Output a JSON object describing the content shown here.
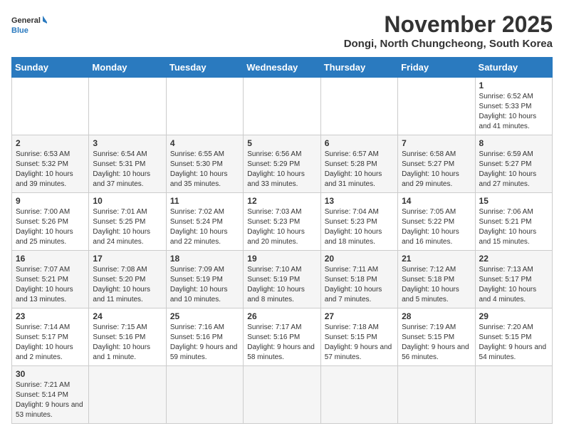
{
  "logo": {
    "text_general": "General",
    "text_blue": "Blue"
  },
  "header": {
    "title": "November 2025",
    "subtitle": "Dongi, North Chungcheong, South Korea"
  },
  "weekdays": [
    "Sunday",
    "Monday",
    "Tuesday",
    "Wednesday",
    "Thursday",
    "Friday",
    "Saturday"
  ],
  "weeks": [
    [
      {
        "day": "",
        "info": ""
      },
      {
        "day": "",
        "info": ""
      },
      {
        "day": "",
        "info": ""
      },
      {
        "day": "",
        "info": ""
      },
      {
        "day": "",
        "info": ""
      },
      {
        "day": "",
        "info": ""
      },
      {
        "day": "1",
        "info": "Sunrise: 6:52 AM\nSunset: 5:33 PM\nDaylight: 10 hours and 41 minutes."
      }
    ],
    [
      {
        "day": "2",
        "info": "Sunrise: 6:53 AM\nSunset: 5:32 PM\nDaylight: 10 hours and 39 minutes."
      },
      {
        "day": "3",
        "info": "Sunrise: 6:54 AM\nSunset: 5:31 PM\nDaylight: 10 hours and 37 minutes."
      },
      {
        "day": "4",
        "info": "Sunrise: 6:55 AM\nSunset: 5:30 PM\nDaylight: 10 hours and 35 minutes."
      },
      {
        "day": "5",
        "info": "Sunrise: 6:56 AM\nSunset: 5:29 PM\nDaylight: 10 hours and 33 minutes."
      },
      {
        "day": "6",
        "info": "Sunrise: 6:57 AM\nSunset: 5:28 PM\nDaylight: 10 hours and 31 minutes."
      },
      {
        "day": "7",
        "info": "Sunrise: 6:58 AM\nSunset: 5:27 PM\nDaylight: 10 hours and 29 minutes."
      },
      {
        "day": "8",
        "info": "Sunrise: 6:59 AM\nSunset: 5:27 PM\nDaylight: 10 hours and 27 minutes."
      }
    ],
    [
      {
        "day": "9",
        "info": "Sunrise: 7:00 AM\nSunset: 5:26 PM\nDaylight: 10 hours and 25 minutes."
      },
      {
        "day": "10",
        "info": "Sunrise: 7:01 AM\nSunset: 5:25 PM\nDaylight: 10 hours and 24 minutes."
      },
      {
        "day": "11",
        "info": "Sunrise: 7:02 AM\nSunset: 5:24 PM\nDaylight: 10 hours and 22 minutes."
      },
      {
        "day": "12",
        "info": "Sunrise: 7:03 AM\nSunset: 5:23 PM\nDaylight: 10 hours and 20 minutes."
      },
      {
        "day": "13",
        "info": "Sunrise: 7:04 AM\nSunset: 5:23 PM\nDaylight: 10 hours and 18 minutes."
      },
      {
        "day": "14",
        "info": "Sunrise: 7:05 AM\nSunset: 5:22 PM\nDaylight: 10 hours and 16 minutes."
      },
      {
        "day": "15",
        "info": "Sunrise: 7:06 AM\nSunset: 5:21 PM\nDaylight: 10 hours and 15 minutes."
      }
    ],
    [
      {
        "day": "16",
        "info": "Sunrise: 7:07 AM\nSunset: 5:21 PM\nDaylight: 10 hours and 13 minutes."
      },
      {
        "day": "17",
        "info": "Sunrise: 7:08 AM\nSunset: 5:20 PM\nDaylight: 10 hours and 11 minutes."
      },
      {
        "day": "18",
        "info": "Sunrise: 7:09 AM\nSunset: 5:19 PM\nDaylight: 10 hours and 10 minutes."
      },
      {
        "day": "19",
        "info": "Sunrise: 7:10 AM\nSunset: 5:19 PM\nDaylight: 10 hours and 8 minutes."
      },
      {
        "day": "20",
        "info": "Sunrise: 7:11 AM\nSunset: 5:18 PM\nDaylight: 10 hours and 7 minutes."
      },
      {
        "day": "21",
        "info": "Sunrise: 7:12 AM\nSunset: 5:18 PM\nDaylight: 10 hours and 5 minutes."
      },
      {
        "day": "22",
        "info": "Sunrise: 7:13 AM\nSunset: 5:17 PM\nDaylight: 10 hours and 4 minutes."
      }
    ],
    [
      {
        "day": "23",
        "info": "Sunrise: 7:14 AM\nSunset: 5:17 PM\nDaylight: 10 hours and 2 minutes."
      },
      {
        "day": "24",
        "info": "Sunrise: 7:15 AM\nSunset: 5:16 PM\nDaylight: 10 hours and 1 minute."
      },
      {
        "day": "25",
        "info": "Sunrise: 7:16 AM\nSunset: 5:16 PM\nDaylight: 9 hours and 59 minutes."
      },
      {
        "day": "26",
        "info": "Sunrise: 7:17 AM\nSunset: 5:16 PM\nDaylight: 9 hours and 58 minutes."
      },
      {
        "day": "27",
        "info": "Sunrise: 7:18 AM\nSunset: 5:15 PM\nDaylight: 9 hours and 57 minutes."
      },
      {
        "day": "28",
        "info": "Sunrise: 7:19 AM\nSunset: 5:15 PM\nDaylight: 9 hours and 56 minutes."
      },
      {
        "day": "29",
        "info": "Sunrise: 7:20 AM\nSunset: 5:15 PM\nDaylight: 9 hours and 54 minutes."
      }
    ],
    [
      {
        "day": "30",
        "info": "Sunrise: 7:21 AM\nSunset: 5:14 PM\nDaylight: 9 hours and 53 minutes."
      },
      {
        "day": "",
        "info": ""
      },
      {
        "day": "",
        "info": ""
      },
      {
        "day": "",
        "info": ""
      },
      {
        "day": "",
        "info": ""
      },
      {
        "day": "",
        "info": ""
      },
      {
        "day": "",
        "info": ""
      }
    ]
  ]
}
